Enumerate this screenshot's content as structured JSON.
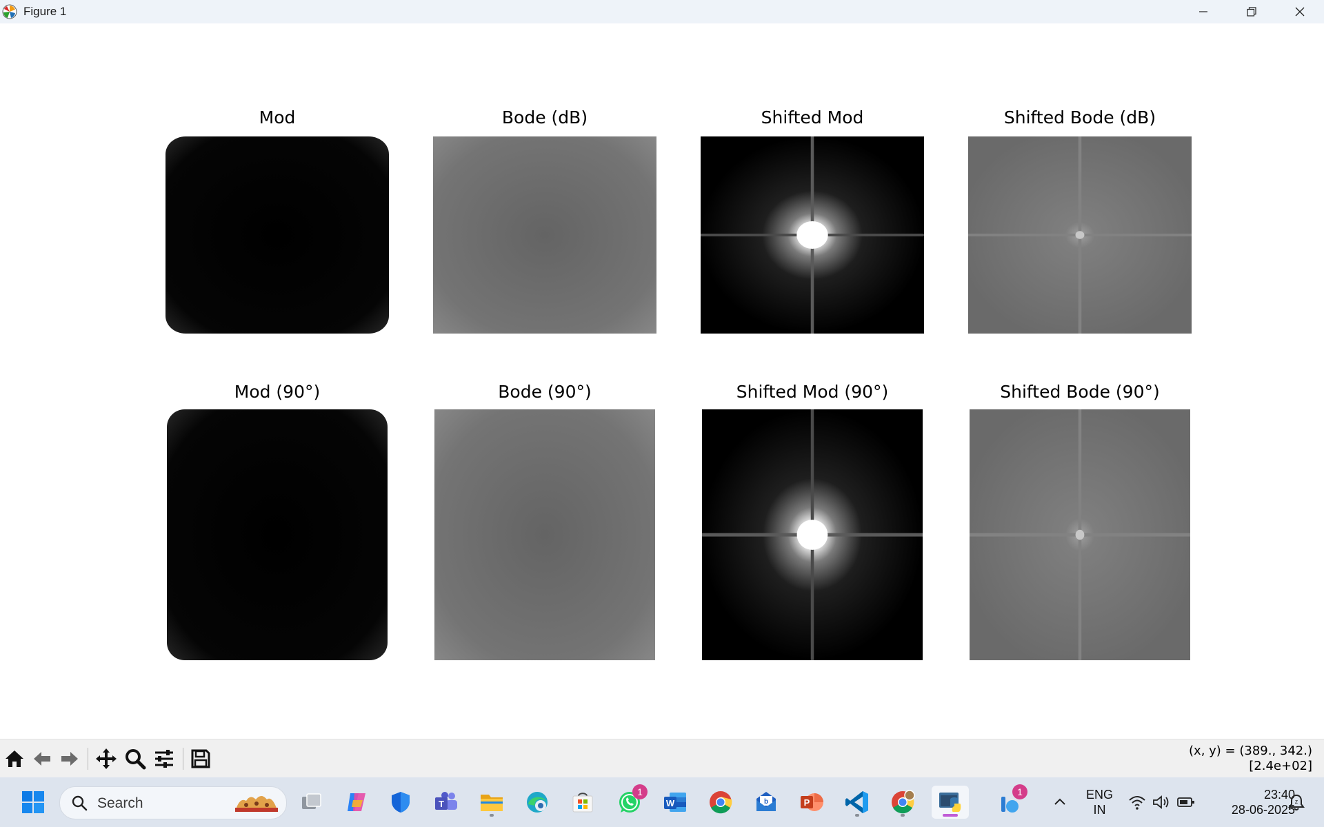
{
  "window": {
    "title": "Figure 1",
    "controls": [
      "minimize-icon",
      "restore-icon",
      "close-icon"
    ]
  },
  "figure": {
    "panels": [
      {
        "title": "Mod",
        "kind": "mod",
        "rotated": false
      },
      {
        "title": "Bode (dB)",
        "kind": "bode",
        "rotated": false
      },
      {
        "title": "Shifted Mod",
        "kind": "shifted-mod",
        "rotated": false
      },
      {
        "title": "Shifted Bode (dB)",
        "kind": "shifted-bode",
        "rotated": false
      },
      {
        "title": "Mod (90°)",
        "kind": "mod",
        "rotated": true
      },
      {
        "title": "Bode (90°)",
        "kind": "bode",
        "rotated": true
      },
      {
        "title": "Shifted Mod (90°)",
        "kind": "shifted-mod",
        "rotated": true
      },
      {
        "title": "Shifted Bode (90°)",
        "kind": "shifted-bode",
        "rotated": true
      }
    ]
  },
  "toolbar": {
    "buttons": [
      "home-icon",
      "back-icon",
      "forward-icon",
      "pan-icon",
      "zoom-icon",
      "configure-subplots-icon",
      "save-icon"
    ],
    "coords_line1": "(x, y) = (389., 342.)",
    "coords_line2": "[2.4e+02]"
  },
  "taskbar": {
    "search_placeholder": "Search",
    "apps": [
      {
        "name": "task-view",
        "badge": ""
      },
      {
        "name": "copilot",
        "badge": ""
      },
      {
        "name": "defender",
        "badge": ""
      },
      {
        "name": "teams",
        "badge": ""
      },
      {
        "name": "file-explorer",
        "badge": ""
      },
      {
        "name": "edge",
        "badge": ""
      },
      {
        "name": "microsoft-store",
        "badge": ""
      },
      {
        "name": "whatsapp",
        "badge": "1"
      },
      {
        "name": "word",
        "badge": ""
      },
      {
        "name": "chrome",
        "badge": ""
      },
      {
        "name": "mail",
        "badge": ""
      },
      {
        "name": "powerpoint",
        "badge": ""
      },
      {
        "name": "vscode",
        "badge": ""
      },
      {
        "name": "chrome-profile",
        "badge": ""
      },
      {
        "name": "python",
        "badge": ""
      },
      {
        "name": "tray-app",
        "badge": "1"
      }
    ],
    "lang_line1": "ENG",
    "lang_line2": "IN",
    "time": "23:40",
    "date": "28-06-2025"
  }
}
